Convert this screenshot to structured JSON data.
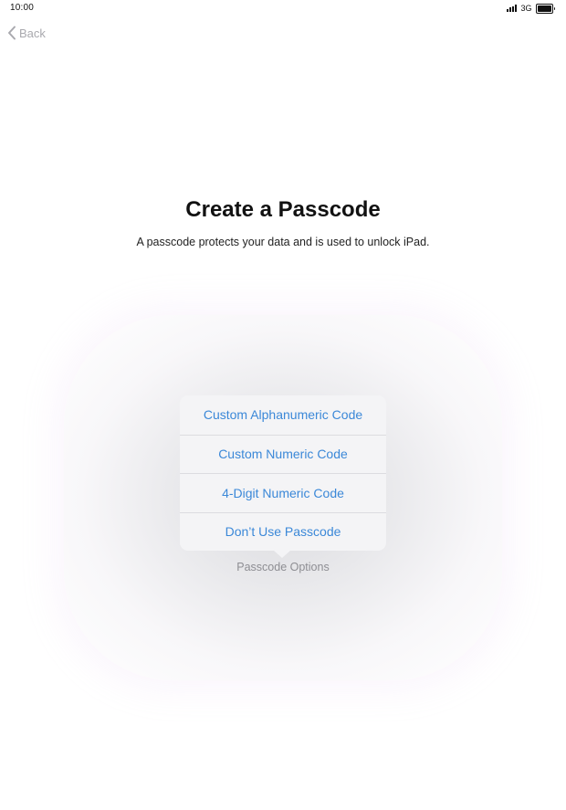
{
  "status_bar": {
    "time": "10:00",
    "network": "3G"
  },
  "nav": {
    "back_label": "Back"
  },
  "header": {
    "title": "Create a Passcode",
    "subtitle": "A passcode protects your data and is used to unlock iPad."
  },
  "passcode_options": {
    "items": [
      {
        "label": "Custom Alphanumeric Code"
      },
      {
        "label": "Custom Numeric Code"
      },
      {
        "label": "4-Digit Numeric Code"
      },
      {
        "label": "Don’t Use Passcode"
      }
    ],
    "caption": "Passcode Options"
  },
  "colors": {
    "accent": "#3b88d8",
    "back": "#a9a9ae",
    "caption": "#8e8e93",
    "popover_bg": "#f4f4f6"
  },
  "icons": {
    "back": "chevron-left-icon",
    "signal": "signal-bars-icon",
    "battery": "battery-icon"
  }
}
